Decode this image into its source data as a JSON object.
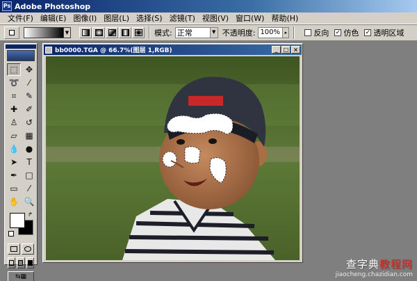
{
  "app": {
    "title": "Adobe Photoshop",
    "icon": "photoshop-app-icon"
  },
  "menubar": {
    "items": [
      "文件(F)",
      "编辑(E)",
      "图像(I)",
      "图层(L)",
      "选择(S)",
      "滤镜(T)",
      "视图(V)",
      "窗口(W)",
      "帮助(H)"
    ]
  },
  "options": {
    "mode_label": "模式:",
    "mode_value": "正常",
    "opacity_label": "不透明度:",
    "opacity_value": "100%",
    "reverse_label": "反向",
    "reverse_checked": false,
    "dither_label": "仿色",
    "dither_checked": true,
    "transparency_label": "透明区域",
    "transparency_checked": true,
    "gradient_types": [
      "linear-gradient-icon",
      "radial-gradient-icon",
      "angle-gradient-icon",
      "reflected-gradient-icon",
      "diamond-gradient-icon"
    ]
  },
  "toolbox": {
    "tools": [
      {
        "name": "marquee-tool-icon",
        "glyph": "⬚"
      },
      {
        "name": "move-tool-icon",
        "glyph": "✥"
      },
      {
        "name": "lasso-tool-icon",
        "glyph": "➰"
      },
      {
        "name": "magic-wand-tool-icon",
        "glyph": "⁄"
      },
      {
        "name": "crop-tool-icon",
        "glyph": "⌗"
      },
      {
        "name": "slice-tool-icon",
        "glyph": "✎"
      },
      {
        "name": "healing-brush-icon",
        "glyph": "✚"
      },
      {
        "name": "brush-tool-icon",
        "glyph": "✐"
      },
      {
        "name": "clone-stamp-icon",
        "glyph": "♙"
      },
      {
        "name": "history-brush-icon",
        "glyph": "↺"
      },
      {
        "name": "eraser-tool-icon",
        "glyph": "▱"
      },
      {
        "name": "gradient-tool-icon",
        "glyph": "▦"
      },
      {
        "name": "blur-tool-icon",
        "glyph": "💧"
      },
      {
        "name": "dodge-tool-icon",
        "glyph": "●"
      },
      {
        "name": "path-select-tool-icon",
        "glyph": "➤"
      },
      {
        "name": "type-tool-icon",
        "glyph": "T"
      },
      {
        "name": "pen-tool-icon",
        "glyph": "✒"
      },
      {
        "name": "shape-tool-icon",
        "glyph": "□"
      },
      {
        "name": "notes-tool-icon",
        "glyph": "▭"
      },
      {
        "name": "eyedropper-tool-icon",
        "glyph": "⁄"
      },
      {
        "name": "hand-tool-icon",
        "glyph": "✋"
      },
      {
        "name": "zoom-tool-icon",
        "glyph": "🔍"
      }
    ],
    "foreground_color": "#ffffff",
    "background_color": "#000000"
  },
  "document": {
    "title": "bb0000.TGA @ 66.7%(图层 1,RGB)",
    "minimize": "_",
    "maximize": "□",
    "close": "×"
  },
  "watermark": {
    "brand": "查字典",
    "section": "教程网",
    "url": "jiaocheng.chazidian.com"
  },
  "colors": {
    "title_blue": "#0a246a",
    "chrome_gray": "#d4d0c8",
    "workspace_gray": "#7f7f7f",
    "watermark_red": "#d9281f"
  }
}
